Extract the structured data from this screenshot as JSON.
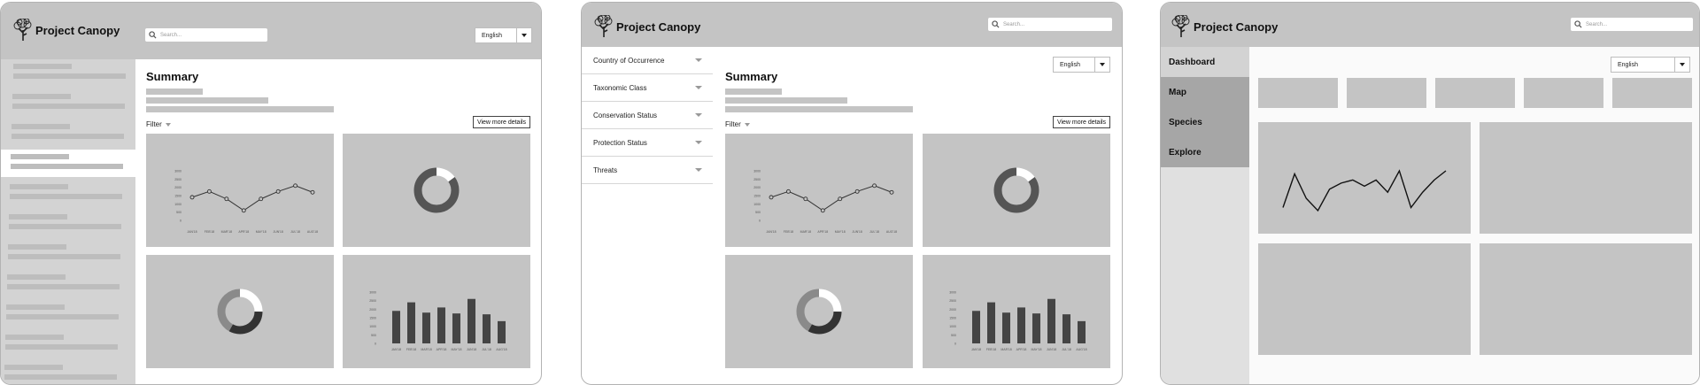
{
  "app": {
    "name": "Project Canopy"
  },
  "search": {
    "placeholder": "Search..."
  },
  "language": {
    "selected": "English"
  },
  "summary": {
    "title": "Summary",
    "filter_label": "Filter",
    "view_more_label": "View more details"
  },
  "charts": {
    "line": {
      "type": "line",
      "categories": [
        "JAN'18",
        "FEB'18",
        "MAR'18",
        "APR'18",
        "MAY'18",
        "JUN'18",
        "JUL'18",
        "AUG'18"
      ],
      "y_ticks": [
        "3000",
        "2500",
        "2000",
        "1500",
        "1000",
        "500",
        "0"
      ],
      "values": [
        1400,
        1750,
        1300,
        600,
        1300,
        1750,
        2100,
        1700
      ],
      "ylim": [
        0,
        3000
      ]
    },
    "bar": {
      "type": "bar",
      "categories": [
        "JAN'18",
        "FEB'18",
        "MAR'18",
        "APR'18",
        "MAY'18",
        "JUN'18",
        "JUL'18",
        "AUG'18"
      ],
      "y_ticks": [
        "3000",
        "2500",
        "2000",
        "1500",
        "1000",
        "500",
        "0"
      ],
      "values": [
        1900,
        2400,
        1800,
        2100,
        1750,
        2600,
        1700,
        1300
      ],
      "ylim": [
        0,
        3000
      ]
    },
    "donut_1": {
      "type": "pie",
      "values": [
        15,
        85
      ],
      "colors": [
        "#ffffff",
        "#555555"
      ]
    },
    "donut_2": {
      "type": "pie",
      "values": [
        25,
        33,
        42
      ],
      "colors": [
        "#ffffff",
        "#333333",
        "#8a8a8a"
      ]
    },
    "dashboard_line": {
      "type": "line",
      "values": [
        2,
        24,
        8,
        0,
        14,
        18,
        20,
        16,
        20,
        12,
        26,
        2,
        12,
        20,
        26
      ]
    }
  },
  "filters": [
    {
      "label": "Country of Occurrence"
    },
    {
      "label": "Taxonomic Class"
    },
    {
      "label": "Conservation Status"
    },
    {
      "label": "Protection Status"
    },
    {
      "label": "Threats"
    }
  ],
  "nav": [
    {
      "label": "Dashboard"
    },
    {
      "label": "Map"
    },
    {
      "label": "Species"
    },
    {
      "label": "Explore"
    }
  ],
  "colors": {
    "panel": "#c4c4c4",
    "header": "#c4c4c4",
    "dark_series": "#444444"
  }
}
